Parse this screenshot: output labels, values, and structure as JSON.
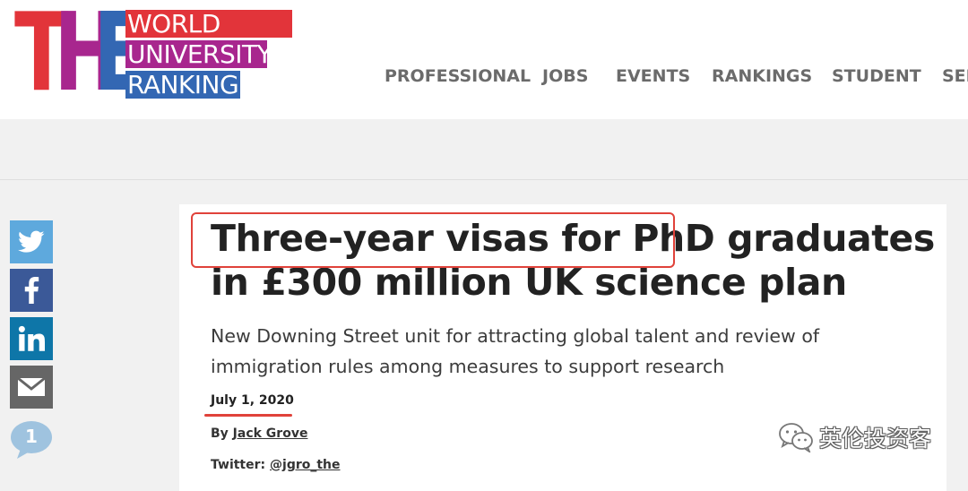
{
  "logo": {
    "letters": [
      "T",
      "H",
      "E"
    ],
    "lines": [
      "WORLD",
      "UNIVERSITY",
      "RANKINGS"
    ],
    "colors": {
      "T": "#e2343a",
      "H": "#a8268e",
      "E": "#3367b3",
      "world_bar": "#e2343a",
      "university_bar": "#a8268e",
      "rankings_bar": "#3367b3"
    }
  },
  "nav": {
    "items": [
      "PROFESSIONAL",
      "JOBS",
      "EVENTS",
      "RANKINGS",
      "STUDENT",
      "SEF"
    ]
  },
  "share": {
    "icons": [
      "twitter-icon",
      "facebook-icon",
      "linkedin-icon",
      "email-icon"
    ],
    "colors": {
      "twitter": "#5ea9dd",
      "facebook": "#3b5998",
      "linkedin": "#0e76a8",
      "email": "#666666",
      "comment": "#9fc3df"
    },
    "comment_count": "1"
  },
  "article": {
    "headline": "Three-year visas for PhD graduates in £300 million UK science plan",
    "standfirst": "New Downing Street unit for attracting global talent and review of immigration rules among measures to support research",
    "date": "July 1, 2020",
    "byline_prefix": "By",
    "author": "Jack Grove",
    "twitter_prefix": "Twitter:",
    "twitter_handle": "@jgro_the"
  },
  "annotation": {
    "color": "#e0423a"
  },
  "watermark": {
    "text": "英伦投资客",
    "icon": "wechat-icon"
  }
}
